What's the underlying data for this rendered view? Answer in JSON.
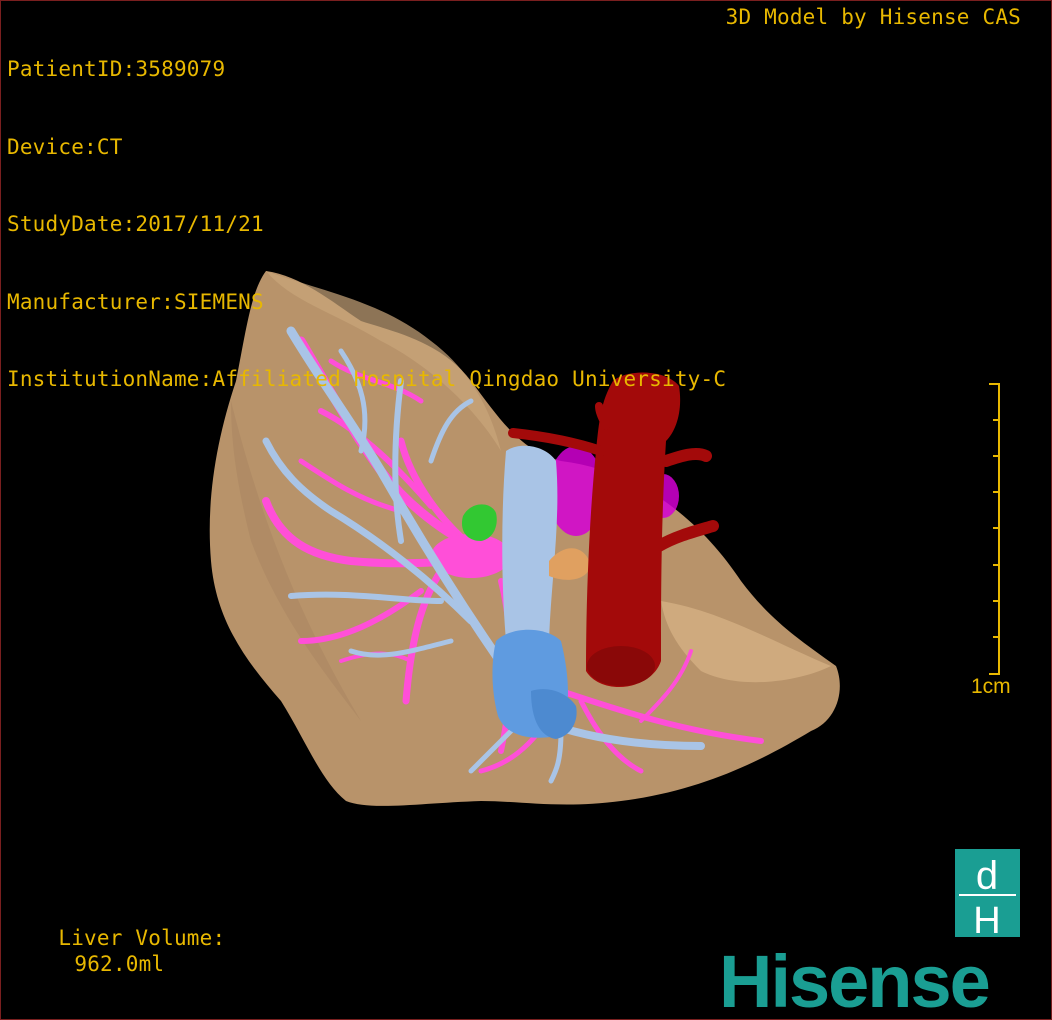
{
  "patient_info": {
    "patient_id": "PatientID:3589079",
    "device": "Device:CT",
    "study_date": "StudyDate:2017/11/21",
    "manufacturer": "Manufacturer:SIEMENS",
    "institution": "InstitutionName:Affiliated Hospital Qingdao University-C"
  },
  "credit": "3D Model by Hisense CAS",
  "volume": {
    "label": "Liver Volume:",
    "value": "962.0ml"
  },
  "scale": {
    "label": "1cm"
  },
  "brand": {
    "name": "Hisense",
    "logo_glyph_top": "d",
    "logo_glyph_bottom": "H"
  },
  "colors": {
    "overlay_text": "#e8b800",
    "liver": "#b8936a",
    "portal_vein": "#ff4fd8",
    "hepatic_vein": "#a9c4e6",
    "ivc": "#5f9be0",
    "aorta": "#a30a0a",
    "gallbladder": "#32c832",
    "brand": "#1a9e93"
  }
}
